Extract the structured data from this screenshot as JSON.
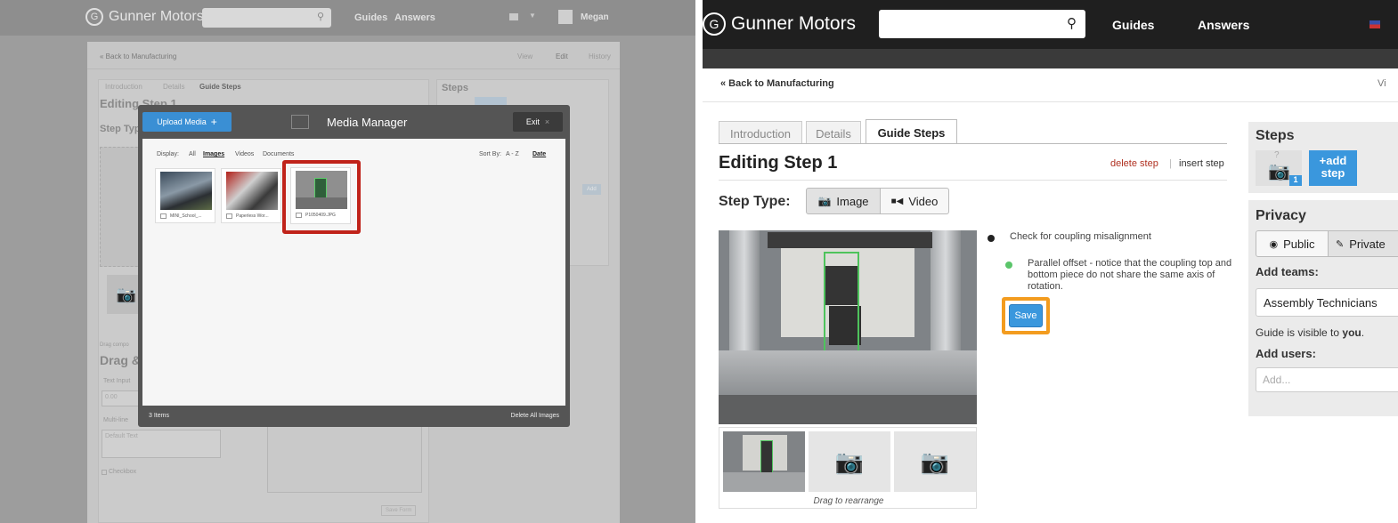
{
  "left": {
    "brand": "Gunner Motors",
    "nav_guides": "Guides",
    "nav_answers": "Answers",
    "user": "Megan",
    "back_link": "« Back to Manufacturing",
    "view_tabs": [
      "View",
      "Edit",
      "History"
    ],
    "tabs": [
      "Introduction",
      "Details",
      "Guide Steps"
    ],
    "editing_title": "Editing Step 1",
    "step_type": "Step Typ",
    "steps_heading": "Steps",
    "add_small": "Add",
    "drag_hint": "Drag compo",
    "drag_heading": "Drag &",
    "text_input_label": "Text Input",
    "text_input_value": "0.00",
    "multiline_label": "Multi-line",
    "default_text": "Default Text",
    "checkbox_label": "Checkbox",
    "save_form": "Save Form",
    "modal": {
      "upload_label": "Upload Media",
      "title": "Media Manager",
      "exit_label": "Exit",
      "display_label": "Display:",
      "filters": [
        "All",
        "Images",
        "Videos",
        "Documents"
      ],
      "sort_label": "Sort By:",
      "sort_options": [
        "A - Z",
        "Date"
      ],
      "thumbs": [
        {
          "name": "MINI_School_..."
        },
        {
          "name": "Paperless Wor..."
        },
        {
          "name": "P1050409.JPG"
        }
      ],
      "count": "3 Items",
      "delete_all": "Delete All Images",
      "highlight_color": "#c0231a"
    }
  },
  "right": {
    "brand": "Gunner Motors",
    "nav_guides": "Guides",
    "nav_answers": "Answers",
    "back_link": "« Back to Manufacturing",
    "view_link": "Vi",
    "tabs": [
      "Introduction",
      "Details",
      "Guide Steps"
    ],
    "editing_title": "Editing Step 1",
    "delete_step": "delete step",
    "separator": "|",
    "insert_step": "insert step",
    "step_type_label": "Step Type:",
    "type_image": "Image",
    "type_video": "Video",
    "bullet1": "Check for coupling misalignment",
    "bullet2": "Parallel offset - notice that the coupling top and bottom piece do not share the same axis of rotation.",
    "save_label": "Save",
    "drag_rearrange": "Drag to rearrange",
    "steps_heading": "Steps",
    "step_number": "1",
    "step_question": "?",
    "add_step_line1": "+add",
    "add_step_line2": "step",
    "privacy_heading": "Privacy",
    "public_label": "Public",
    "private_label": "Private",
    "add_teams": "Add teams:",
    "team_value": "Assembly Technicians",
    "visible_prefix": "Guide is visible to",
    "visible_you": "you",
    "visible_suffix": ".",
    "add_users": "Add users:",
    "users_placeholder": "Add...",
    "highlight_color": "#f39c1f",
    "accent_blue": "#3a97dd"
  }
}
